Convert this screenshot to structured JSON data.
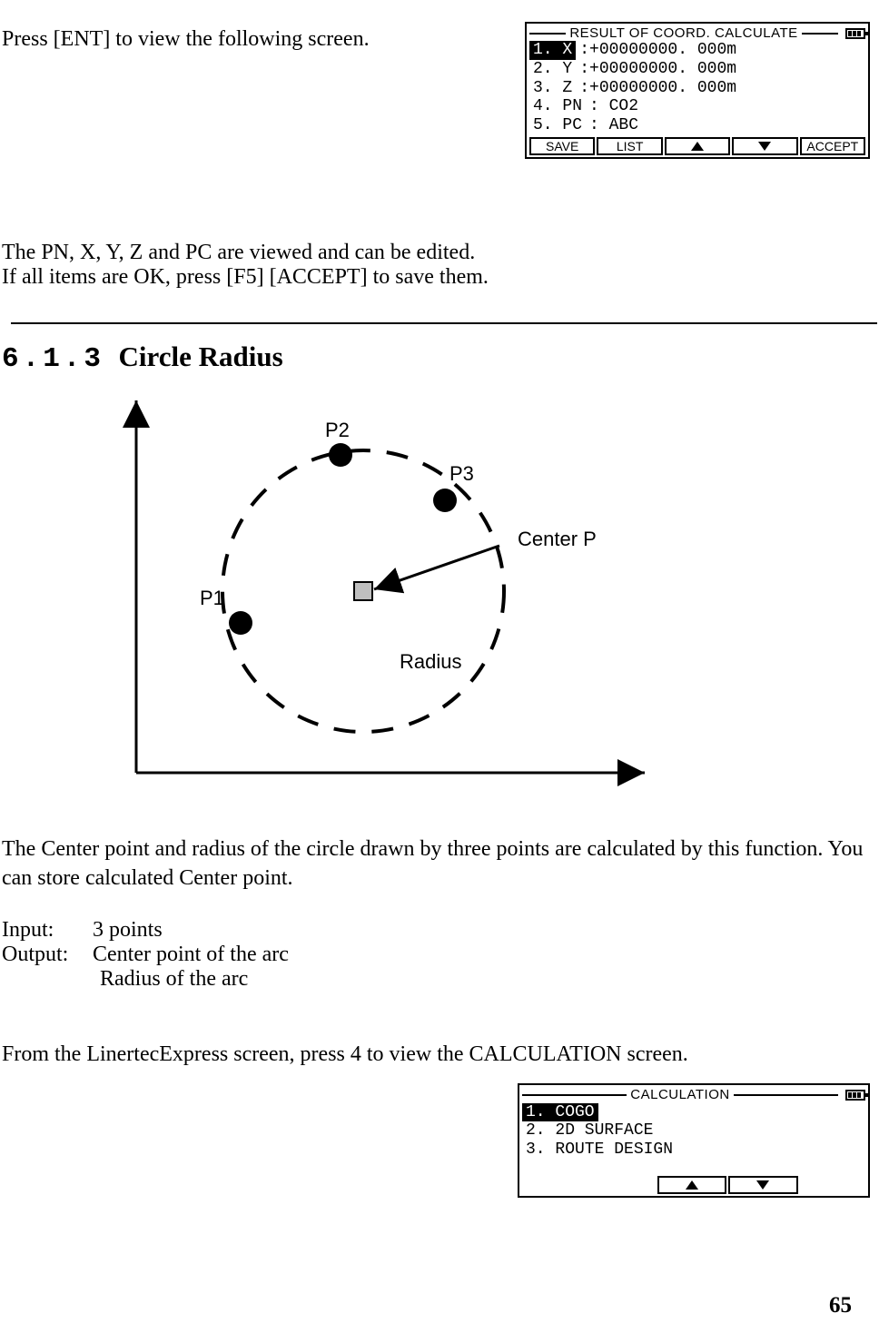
{
  "top_text": "Press [ENT] to view the following screen.",
  "lcd1": {
    "title": "RESULT OF COORD. CALCULATE",
    "lines": [
      {
        "selected": true,
        "label": "1. X ",
        "value": ":+00000000. 000m"
      },
      {
        "selected": false,
        "label": "2. Y ",
        "value": ":+00000000. 000m"
      },
      {
        "selected": false,
        "label": "3. Z ",
        "value": ":+00000000. 000m"
      },
      {
        "selected": false,
        "label": "4. PN",
        "value": ": CO2"
      },
      {
        "selected": false,
        "label": "5. PC",
        "value": ": ABC"
      }
    ],
    "softkeys": {
      "k1": "SAVE",
      "k2": "LIST",
      "k5": "ACCEPT"
    }
  },
  "para1": "The PN, X, Y, Z and PC are viewed and can be edited.",
  "para2": "If all items are OK, press [F5] [ACCEPT] to save them.",
  "heading_num": "6.1.3",
  "heading_text": "Circle Radius",
  "diagram": {
    "p1": "P1",
    "p2": "P2",
    "p3": "P3",
    "center": "Center P",
    "radius": "Radius"
  },
  "desc_text": "The Center point and radius of the circle drawn by three points are calculated by this function. You can store calculated Center point.",
  "input_label": "Input:",
  "input_value": "3 points",
  "output_label": "Output:",
  "output_value1": "Center point of the arc",
  "output_value2": "Radius of the arc",
  "nav_text": "From the LinertecExpress screen, press 4 to view the CALCULATION screen.",
  "lcd2": {
    "title": "CALCULATION",
    "lines": [
      {
        "selected": true,
        "label": "1. COGO"
      },
      {
        "selected": false,
        "label": "2. 2D SURFACE"
      },
      {
        "selected": false,
        "label": "3. ROUTE DESIGN"
      }
    ]
  },
  "page_number": "65"
}
